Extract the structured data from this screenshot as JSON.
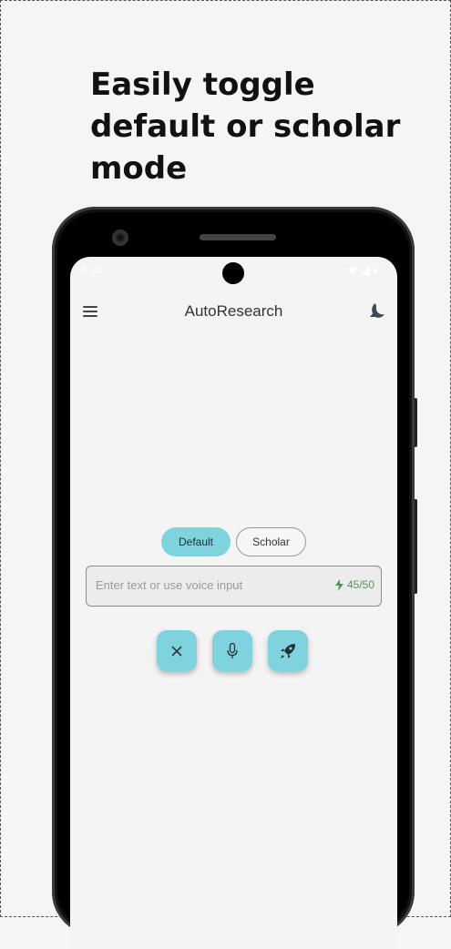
{
  "promo": {
    "headline": "Easily toggle default or scholar mode"
  },
  "status_bar": {
    "time": "8:18"
  },
  "app_bar": {
    "title": "AutoResearch",
    "menu_icon": "hamburger-menu-icon",
    "mode_icon": "dark-mode-icon"
  },
  "mode_toggle": {
    "options": [
      "Default",
      "Scholar"
    ],
    "selected": "Default"
  },
  "input": {
    "placeholder": "Enter text or use voice input",
    "value": "",
    "counter": "45/50",
    "counter_icon": "lightning-bolt-icon"
  },
  "actions": {
    "clear_icon": "close-icon",
    "voice_icon": "microphone-icon",
    "submit_icon": "rocket-icon"
  },
  "colors": {
    "accent": "#7fd3df",
    "counter": "#4a9a4a",
    "background": "#f4f4f4"
  }
}
